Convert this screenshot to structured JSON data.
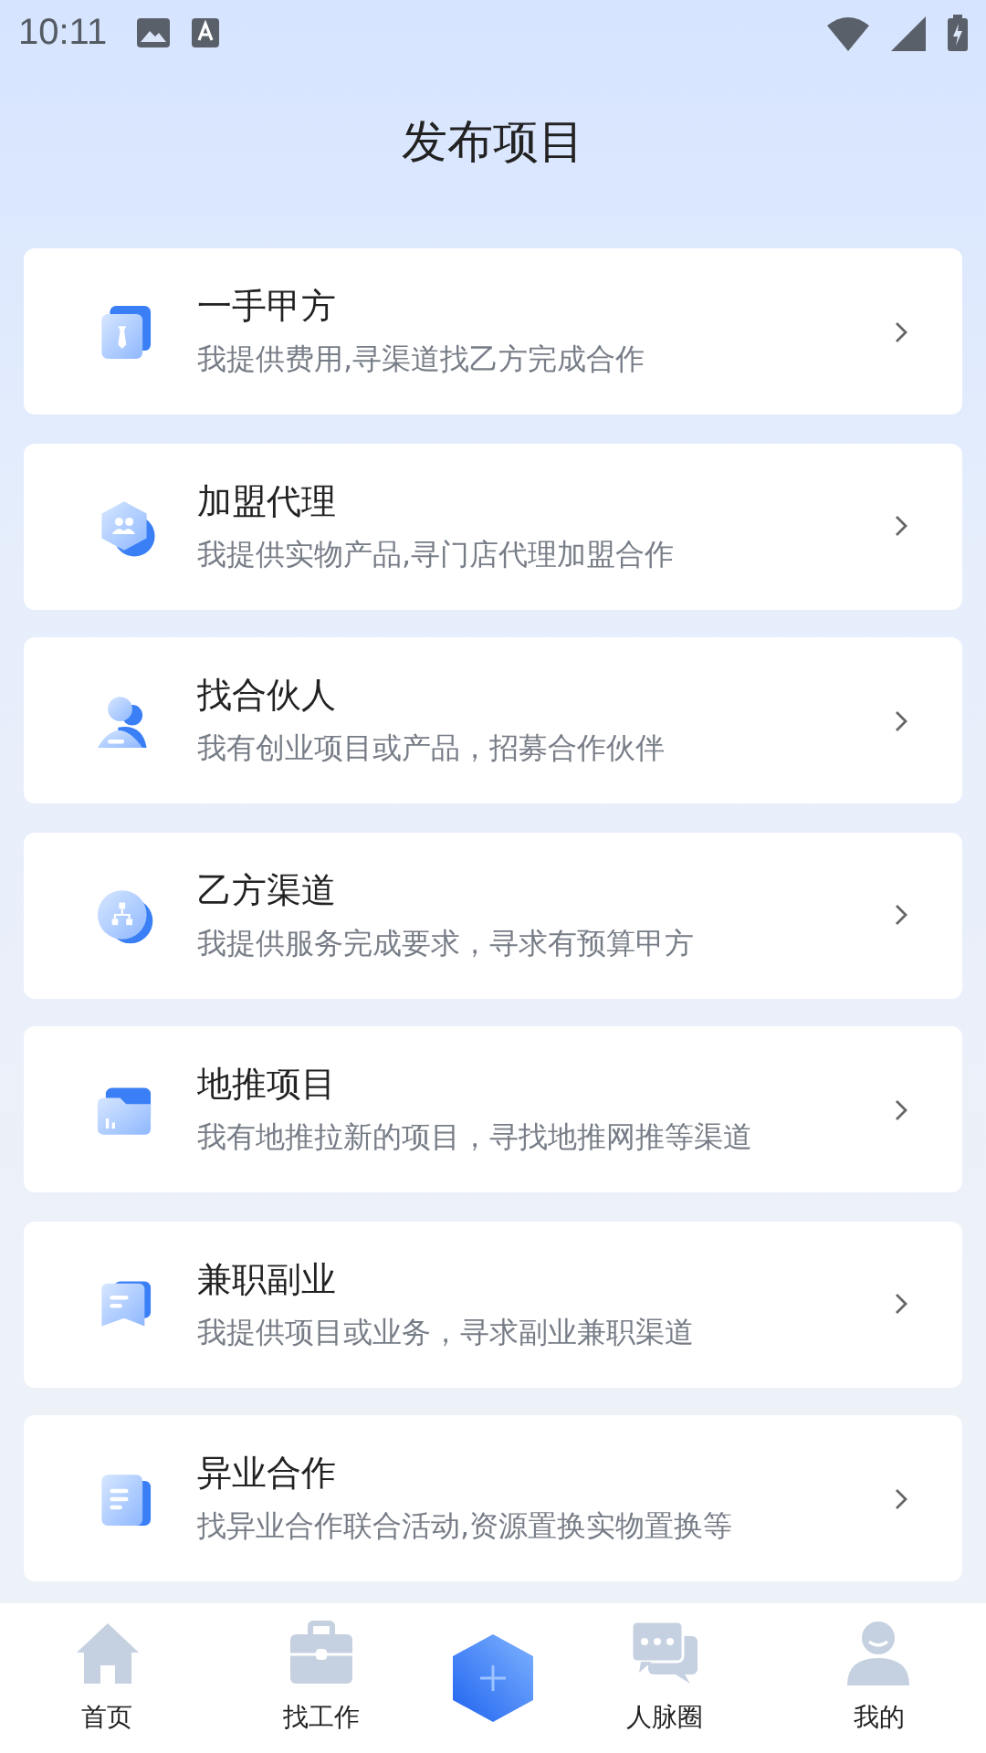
{
  "status_bar": {
    "time": "10:11"
  },
  "title": "发布项目",
  "items": [
    {
      "kind": "badge",
      "title": "一手甲方",
      "subtitle": "我提供费用,寻渠道找乙方完成合作"
    },
    {
      "kind": "hexagon",
      "title": "加盟代理",
      "subtitle": "我提供实物产品,寻门店代理加盟合作"
    },
    {
      "kind": "person",
      "title": "找合伙人",
      "subtitle": "我有创业项目或产品，招募合作伙伴"
    },
    {
      "kind": "network",
      "title": "乙方渠道",
      "subtitle": "我提供服务完成要求，寻求有预算甲方"
    },
    {
      "kind": "folder",
      "title": "地推项目",
      "subtitle": "我有地推拉新的项目，寻找地推网推等渠道"
    },
    {
      "kind": "chat",
      "title": "兼职副业",
      "subtitle": "我提供项目或业务，寻求副业兼职渠道"
    },
    {
      "kind": "document",
      "title": "异业合作",
      "subtitle": "找异业合作联合活动,资源置换实物置换等"
    }
  ],
  "nav": [
    {
      "kind": "home",
      "label": "首页",
      "selected": false
    },
    {
      "kind": "briefcase",
      "label": "找工作",
      "selected": false
    },
    {
      "kind": "publish",
      "selected": true
    },
    {
      "kind": "chat",
      "label": "人脉圈",
      "selected": false
    },
    {
      "kind": "user",
      "label": "我的",
      "selected": false
    }
  ]
}
